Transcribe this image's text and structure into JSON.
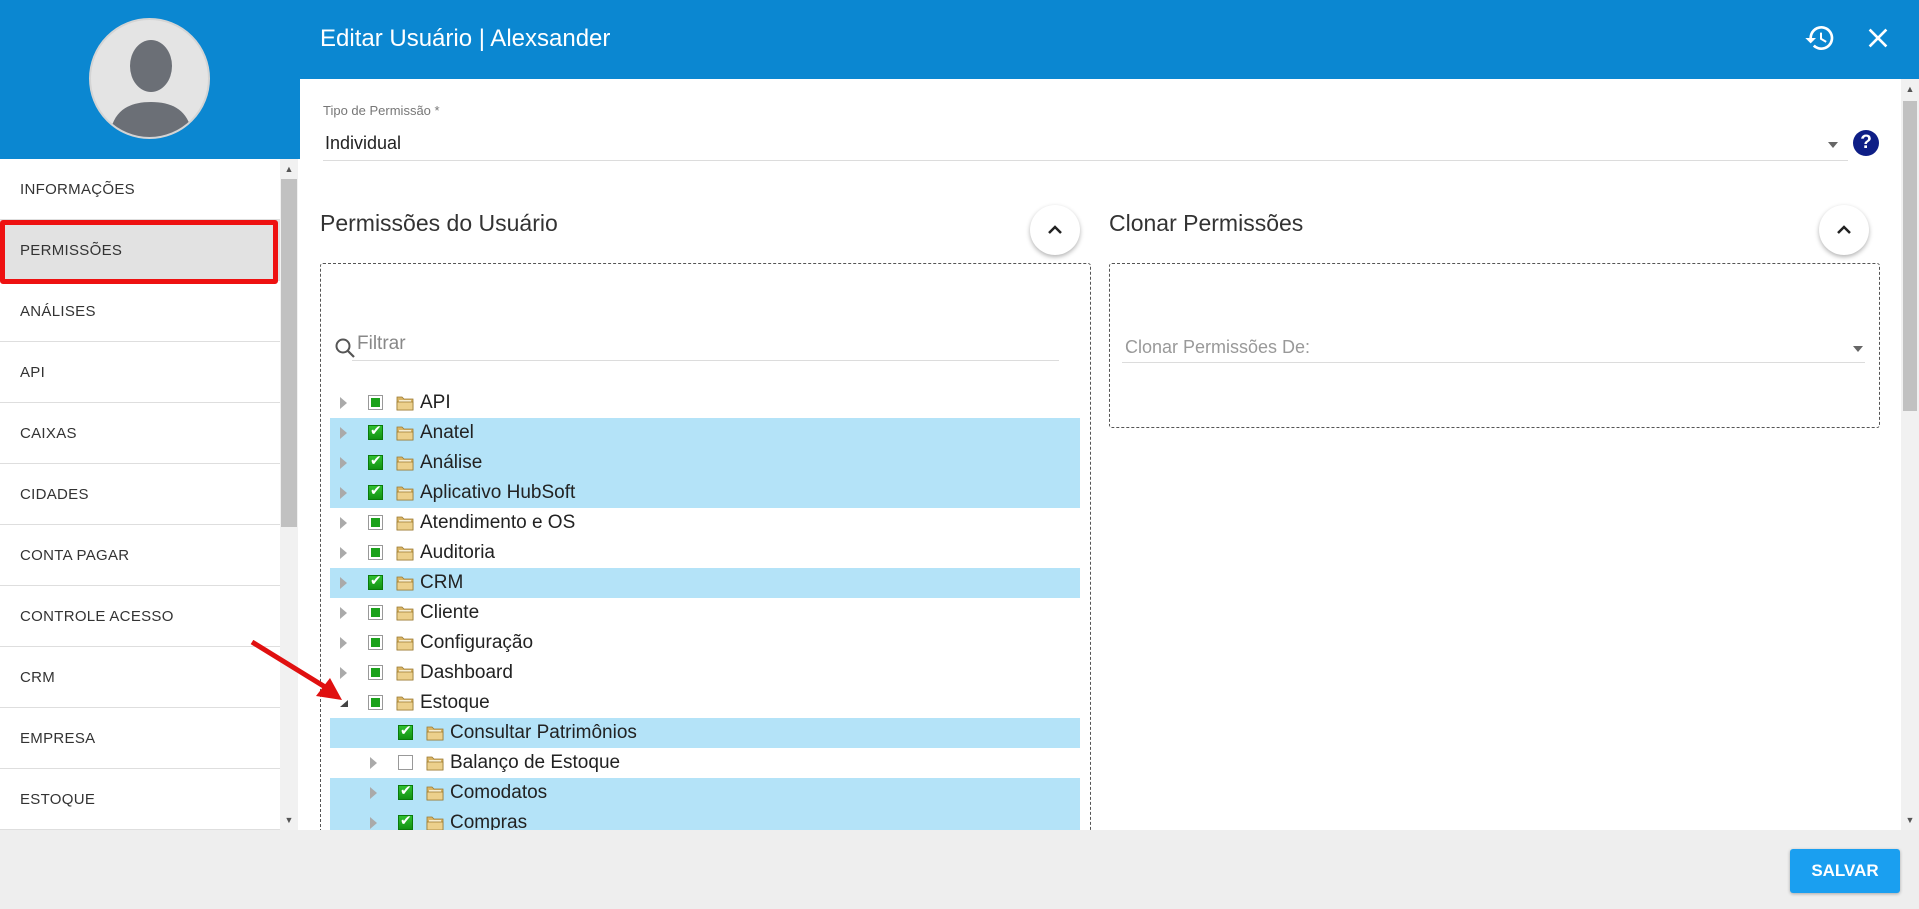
{
  "header": {
    "title": "Editar Usuário | Alexsander"
  },
  "sidebar": {
    "items": [
      {
        "label": "INFORMAÇÕES"
      },
      {
        "label": "PERMISSÕES"
      },
      {
        "label": "ANÁLISES"
      },
      {
        "label": "API"
      },
      {
        "label": "CAIXAS"
      },
      {
        "label": "CIDADES"
      },
      {
        "label": "CONTA PAGAR"
      },
      {
        "label": "CONTROLE ACESSO"
      },
      {
        "label": "CRM"
      },
      {
        "label": "EMPRESA"
      },
      {
        "label": "ESTOQUE"
      }
    ]
  },
  "permission_type": {
    "label": "Tipo de Permissão *",
    "value": "Individual"
  },
  "user_permissions": {
    "title": "Permissões do Usuário",
    "filter_placeholder": "Filtrar",
    "tree": [
      {
        "label": "API",
        "state": "partial",
        "selected": false,
        "level": 0,
        "expanded": false
      },
      {
        "label": "Anatel",
        "state": "checked",
        "selected": true,
        "level": 0,
        "expanded": false
      },
      {
        "label": "Análise",
        "state": "checked",
        "selected": true,
        "level": 0,
        "expanded": false
      },
      {
        "label": "Aplicativo HubSoft",
        "state": "checked",
        "selected": true,
        "level": 0,
        "expanded": false
      },
      {
        "label": "Atendimento e OS",
        "state": "partial",
        "selected": false,
        "level": 0,
        "expanded": false
      },
      {
        "label": "Auditoria",
        "state": "partial",
        "selected": false,
        "level": 0,
        "expanded": false
      },
      {
        "label": "CRM",
        "state": "checked",
        "selected": true,
        "level": 0,
        "expanded": false
      },
      {
        "label": "Cliente",
        "state": "partial",
        "selected": false,
        "level": 0,
        "expanded": false
      },
      {
        "label": "Configuração",
        "state": "partial",
        "selected": false,
        "level": 0,
        "expanded": false
      },
      {
        "label": "Dashboard",
        "state": "partial",
        "selected": false,
        "level": 0,
        "expanded": false
      },
      {
        "label": "Estoque",
        "state": "partial",
        "selected": false,
        "level": 0,
        "expanded": true
      },
      {
        "label": "Consultar Patrimônios",
        "state": "checked",
        "selected": true,
        "level": 1,
        "leaf": true
      },
      {
        "label": "Balanço de Estoque",
        "state": "unchecked",
        "selected": false,
        "level": 1,
        "expanded": false
      },
      {
        "label": "Comodatos",
        "state": "checked",
        "selected": true,
        "level": 1,
        "expanded": false
      },
      {
        "label": "Compras",
        "state": "checked",
        "selected": true,
        "level": 1,
        "expanded": false
      }
    ]
  },
  "clone_permissions": {
    "title": "Clonar Permissões",
    "placeholder": "Clonar Permissões De:"
  },
  "footer": {
    "save_label": "SALVAR"
  },
  "colors": {
    "primary": "#0b87d1",
    "selected_row": "#b4e3f8",
    "save": "#1a9ff0",
    "highlight": "#ee1111"
  },
  "icons": {
    "history": "history-icon",
    "close": "close-icon",
    "help": "help-icon",
    "search": "search-icon"
  }
}
